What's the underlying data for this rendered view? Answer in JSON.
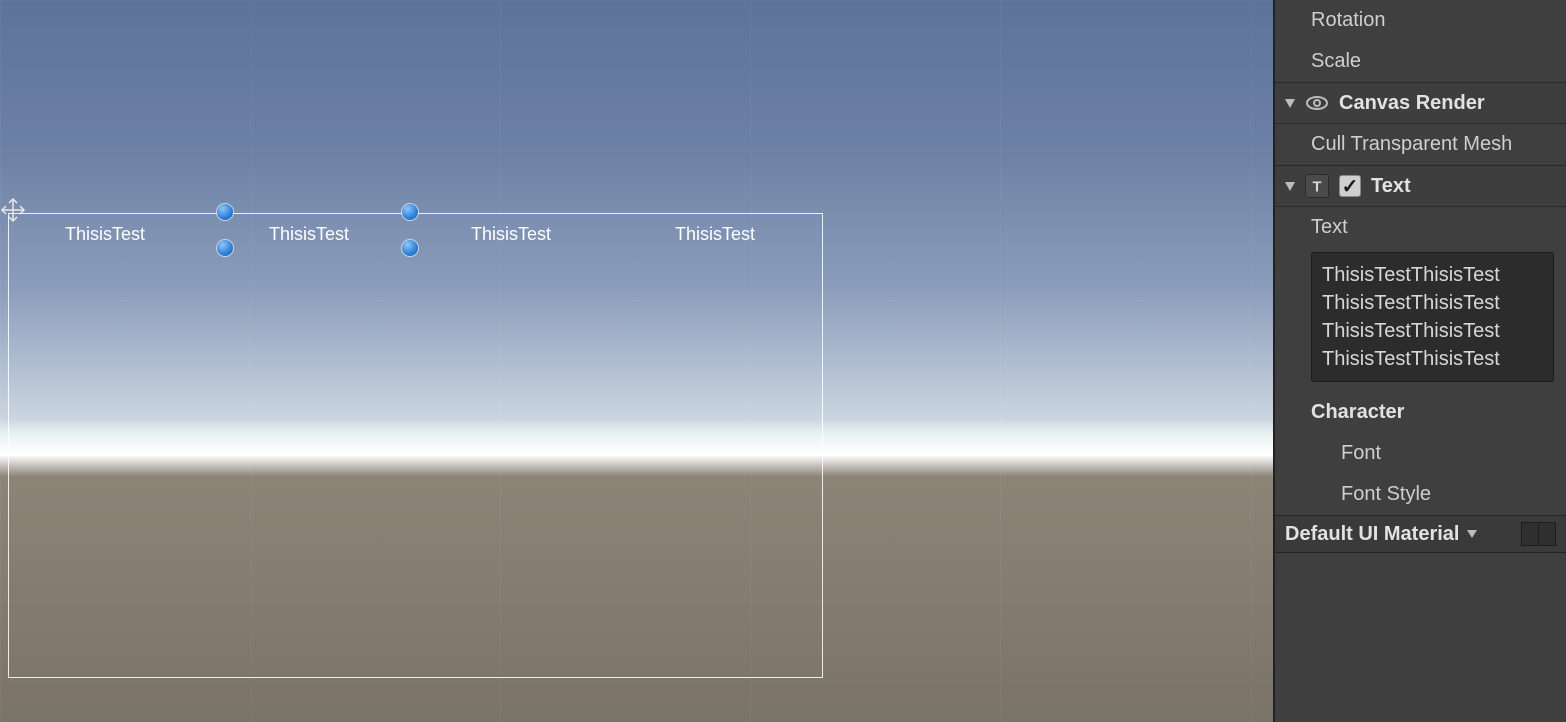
{
  "scene": {
    "canvas_texts": [
      "ThisisTest",
      "ThisisTest",
      "ThisisTest",
      "ThisisTest"
    ]
  },
  "inspector": {
    "transform": {
      "rotation_label": "Rotation",
      "scale_label": "Scale"
    },
    "canvas_renderer": {
      "title": "Canvas Render",
      "cull_label": "Cull Transparent Mesh"
    },
    "text_component": {
      "title": "Text",
      "checked": true,
      "text_label": "Text",
      "text_lines": [
        "ThisisTestThisisTest",
        "ThisisTestThisisTest",
        "ThisisTestThisisTest",
        "ThisisTestThisisTest"
      ],
      "character_label": "Character",
      "font_label": "Font",
      "font_style_label": "Font Style"
    },
    "material": {
      "title": "Default UI Material"
    }
  }
}
